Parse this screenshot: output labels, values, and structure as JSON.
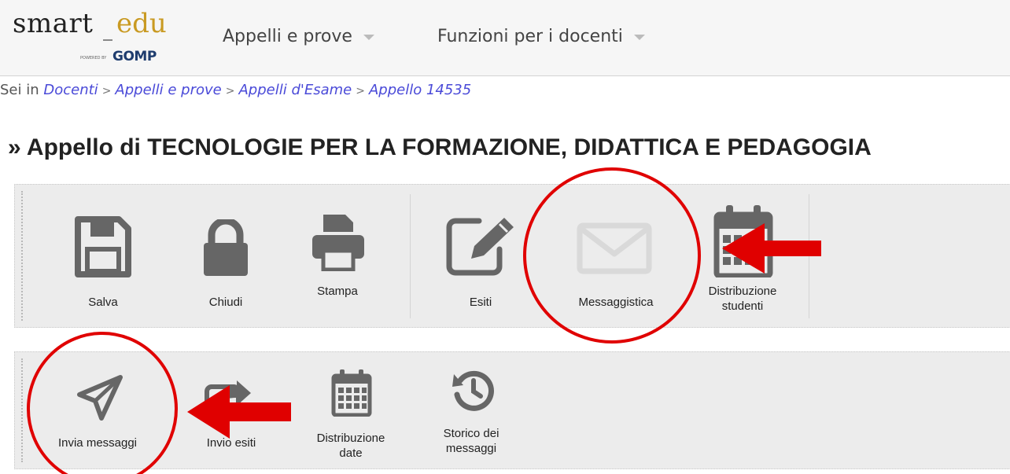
{
  "header": {
    "logo": {
      "smart": "smart",
      "edu": "edu",
      "powered": "POWERED BY",
      "gomp": "GOMP"
    },
    "nav": [
      {
        "label": "Appelli e prove"
      },
      {
        "label": "Funzioni per i docenti"
      }
    ]
  },
  "breadcrumb": {
    "prefix": "Sei in",
    "items": [
      "Docenti",
      "Appelli e prove",
      "Appelli d'Esame",
      "Appello 14535"
    ]
  },
  "page_title": "» Appello di TECNOLOGIE PER LA FORMAZIONE, DIDATTICA E PEDAGOGIA",
  "toolbar1": {
    "buttons": [
      {
        "label": "Salva",
        "icon": "floppy-disk-icon"
      },
      {
        "label": "Chiudi",
        "icon": "lock-icon"
      },
      {
        "label": "Stampa",
        "icon": "printer-icon"
      },
      {
        "label": "Esiti",
        "icon": "edit-icon"
      },
      {
        "label": "Messaggistica",
        "icon": "envelope-icon"
      },
      {
        "label": "Distribuzione studenti",
        "label_lines": [
          "Distribuzione",
          "studenti"
        ],
        "icon": "calendar-icon"
      }
    ]
  },
  "toolbar2": {
    "buttons": [
      {
        "label": "Invia messaggi",
        "icon": "paper-plane-icon"
      },
      {
        "label": "Invio esiti",
        "icon": "share-icon"
      },
      {
        "label": "Distribuzione date",
        "label_lines": [
          "Distribuzione",
          "date"
        ],
        "icon": "calendar-icon"
      },
      {
        "label": "Storico dei messaggi",
        "label_lines": [
          "Storico dei",
          "messaggi"
        ],
        "icon": "history-icon"
      }
    ]
  },
  "colors": {
    "annotation": "#e00000",
    "icon": "#666666",
    "icon_disabled": "#d9d9d9",
    "link": "#4a4ad8"
  }
}
